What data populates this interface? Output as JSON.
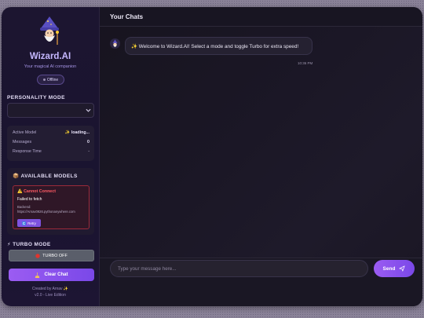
{
  "sidebar": {
    "app_title": "Wizard.AI",
    "app_subtitle": "Your magical AI companion",
    "status_badge": "Offline",
    "personality_label": "PERSONALITY MODE",
    "personality_value": "",
    "stats": [
      {
        "label": "Active Model",
        "value": "✨ loading..."
      },
      {
        "label": "Messages",
        "value": "0"
      },
      {
        "label": "Response Time",
        "value": "-"
      }
    ],
    "models_label": "📦 AVAILABLE MODELS",
    "error": {
      "title": "⚠️ Cannot Connect",
      "message": "Failed to fetch",
      "backend_label": "Backend:",
      "backend_url": "https://Arnav0926.pythonanywhere.com",
      "retry_label": "Retry"
    },
    "turbo_label": "⚡ TURBO MODE",
    "turbo_button": "TURBO OFF",
    "clear_button": "Clear Chat",
    "footer_line1": "Created by Arnav ✨",
    "footer_line2": "v2.0 - Live Edition"
  },
  "main": {
    "header_title": "Your Chats",
    "messages": [
      {
        "text": "✨ Welcome to Wizard.AI! Select a mode and toggle Turbo for extra speed!",
        "time": "10:36 PM"
      }
    ],
    "input_placeholder": "Type your message here...",
    "send_label": "Send"
  },
  "colors": {
    "accent": "#8b55ef",
    "error": "#ff5a63",
    "title": "#c6b8ff"
  },
  "icons": [
    "wizard-icon",
    "chevron-down-icon",
    "refresh-icon",
    "red-circle-icon",
    "broom-icon",
    "send-icon"
  ]
}
